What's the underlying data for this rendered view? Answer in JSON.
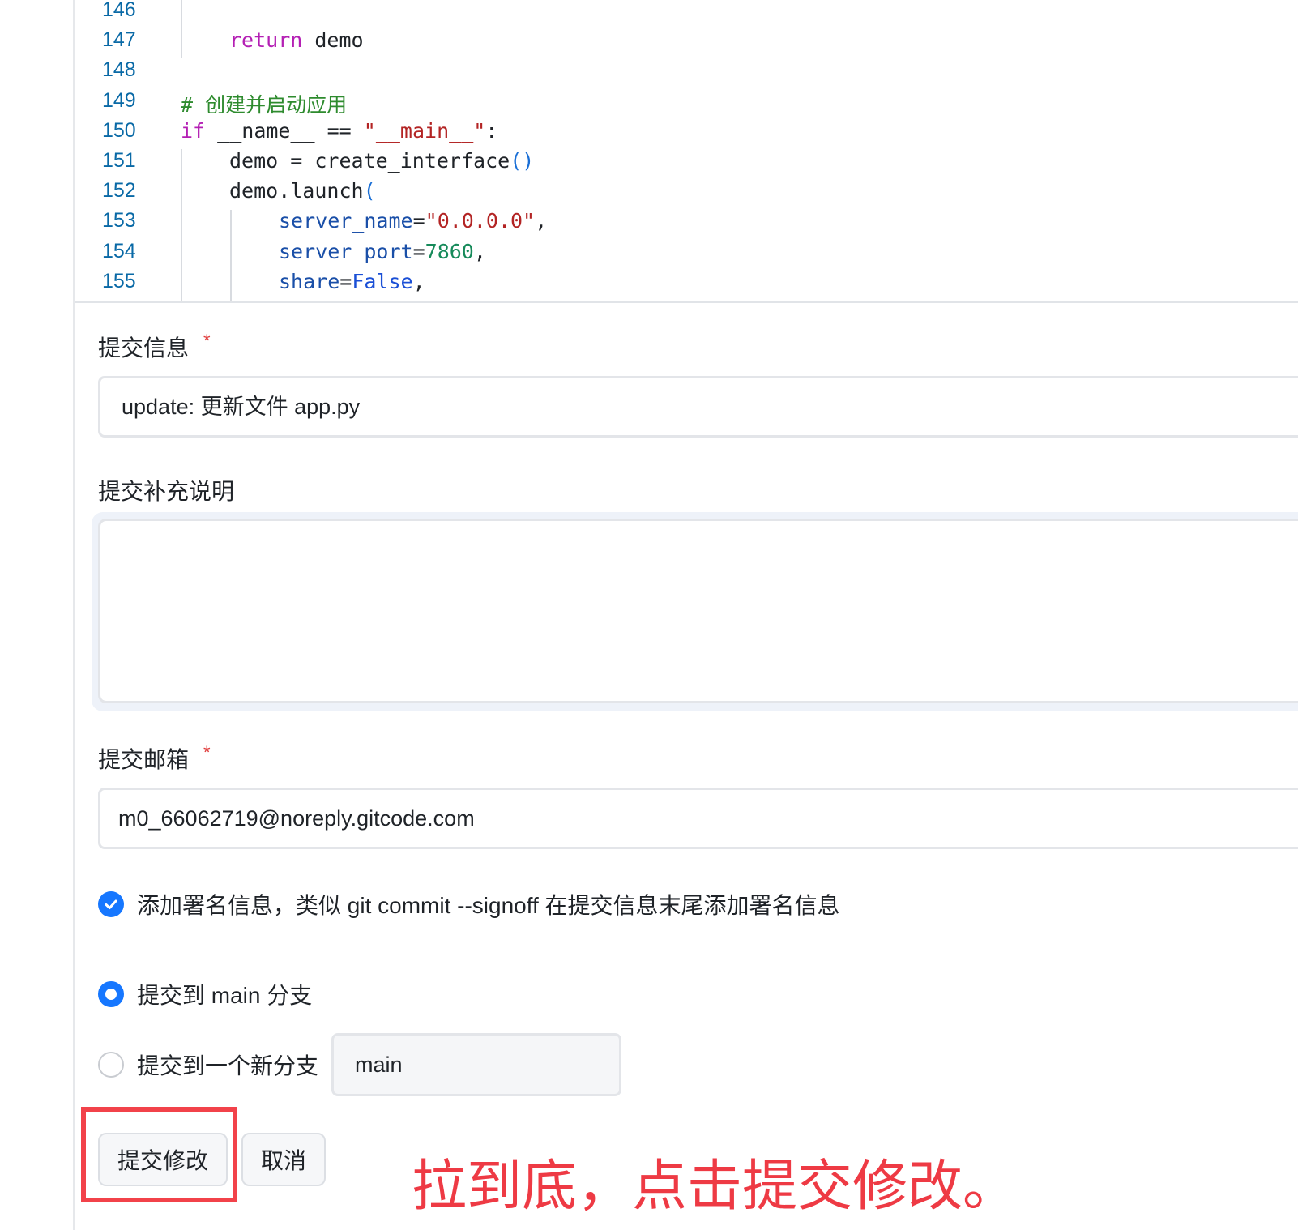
{
  "code_viewer": {
    "lines": [
      {
        "number": "146",
        "parts": []
      },
      {
        "number": "147",
        "parts": [
          {
            "t": "return",
            "c": "kw"
          },
          {
            "t": " demo",
            "c": ""
          }
        ]
      },
      {
        "number": "148",
        "parts": []
      },
      {
        "number": "149",
        "parts": [
          {
            "t": "# 创建并启动应用",
            "c": "cm"
          }
        ]
      },
      {
        "number": "150",
        "parts": [
          {
            "t": "if",
            "c": "kw"
          },
          {
            "t": " __name__ == ",
            "c": ""
          },
          {
            "t": "\"__main__\"",
            "c": "str"
          },
          {
            "t": ":",
            "c": ""
          }
        ]
      },
      {
        "number": "151",
        "parts": [
          {
            "t": "demo = create_interface",
            "c": ""
          },
          {
            "t": "()",
            "c": "par"
          }
        ]
      },
      {
        "number": "152",
        "parts": [
          {
            "t": "demo.launch",
            "c": ""
          },
          {
            "t": "(",
            "c": "par"
          }
        ]
      },
      {
        "number": "153",
        "parts": [
          {
            "t": "server_name",
            "c": "arg"
          },
          {
            "t": "=",
            "c": ""
          },
          {
            "t": "\"0.0.0.0\"",
            "c": "str"
          },
          {
            "t": ",",
            "c": ""
          }
        ]
      },
      {
        "number": "154",
        "parts": [
          {
            "t": "server_port",
            "c": "arg"
          },
          {
            "t": "=",
            "c": ""
          },
          {
            "t": "7860",
            "c": "num"
          },
          {
            "t": ",",
            "c": ""
          }
        ]
      },
      {
        "number": "155",
        "parts": [
          {
            "t": "share",
            "c": "arg"
          },
          {
            "t": "=",
            "c": ""
          },
          {
            "t": "False",
            "c": "const"
          },
          {
            "t": ",",
            "c": ""
          }
        ]
      }
    ]
  },
  "form": {
    "commit_message": {
      "label": "提交信息",
      "required_mark": "*",
      "value": "update: 更新文件 app.py"
    },
    "commit_description": {
      "label": "提交补充说明",
      "value": ""
    },
    "commit_email": {
      "label": "提交邮箱",
      "required_mark": "*",
      "value": "m0_66062719@noreply.gitcode.com"
    },
    "signoff": {
      "checked": true,
      "label": "添加署名信息，类似 git commit --signoff 在提交信息末尾添加署名信息"
    },
    "branch_options": {
      "current": {
        "label": "提交到 main 分支",
        "selected": true
      },
      "new_branch": {
        "label": "提交到一个新分支",
        "selected": false,
        "input_value": "main"
      }
    },
    "buttons": {
      "submit": "提交修改",
      "cancel": "取消"
    }
  },
  "annotation": {
    "text": "拉到底，点击提交修改。",
    "color": "#ee3a44"
  },
  "colors": {
    "accent": "#1677ff",
    "line_number": "#0969a6",
    "keyword": "#b41fb4",
    "comment": "#2e8b2e",
    "string": "#b32424",
    "highlight": "#f2424a"
  }
}
